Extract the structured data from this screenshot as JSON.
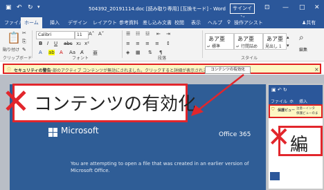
{
  "titlebar": {
    "filename": "504392_20191114.doc [読み取り専用] [互換モード] - Word",
    "signin": "サインイン",
    "qat_icons": [
      "save-icon",
      "undo-icon",
      "redo-icon"
    ],
    "minimize": "—",
    "restore": "□",
    "close": "✕"
  },
  "menu": {
    "tabs": [
      "ファイル",
      "ホーム",
      "挿入",
      "デザイン",
      "レイアウト",
      "参考資料",
      "差し込み文書",
      "校閲",
      "表示",
      "ヘルプ",
      "操作アシスト"
    ],
    "active_tab": "ホーム",
    "share": "共有"
  },
  "ribbon": {
    "paste_label": "貼り付け",
    "font_name": "Calibri",
    "font_size": "11",
    "groups": {
      "clipboard": "クリップボード",
      "font": "フォント",
      "paragraph": "段落",
      "styles": "スタイル"
    },
    "styles": [
      {
        "preview": "あア亜",
        "name": "標準"
      },
      {
        "preview": "あア亜",
        "name": "行間詰め"
      },
      {
        "preview": "あア亜",
        "name": "見出し 1"
      }
    ],
    "edit_label": "編集"
  },
  "security_bar": {
    "title": "セキュリティの警告",
    "message": "一部のアクティブ コンテンツが無効にされました。クリックすると詳細が表示されます。",
    "button": "コンテンツの有効化",
    "close": "×"
  },
  "callout": {
    "text": "コンテンツの有効化"
  },
  "banner": {
    "brand": "Microsoft",
    "product": "Office 365",
    "message": "You are attempting to open a file that was created in an earlier version of Microsoft Office."
  },
  "inset": {
    "tabs": [
      "ファイル",
      "ホ",
      "挿入"
    ],
    "protected_title": "保護ビュー",
    "protected_line1": "注意—インタ",
    "protected_line2": "保護ビューのま",
    "edit_text": "編"
  },
  "colors": {
    "word_blue": "#2b579a",
    "warning_yellow": "#fdf7c3",
    "highlight_red": "#e2262c",
    "banner_blue": "#2f5d96"
  }
}
